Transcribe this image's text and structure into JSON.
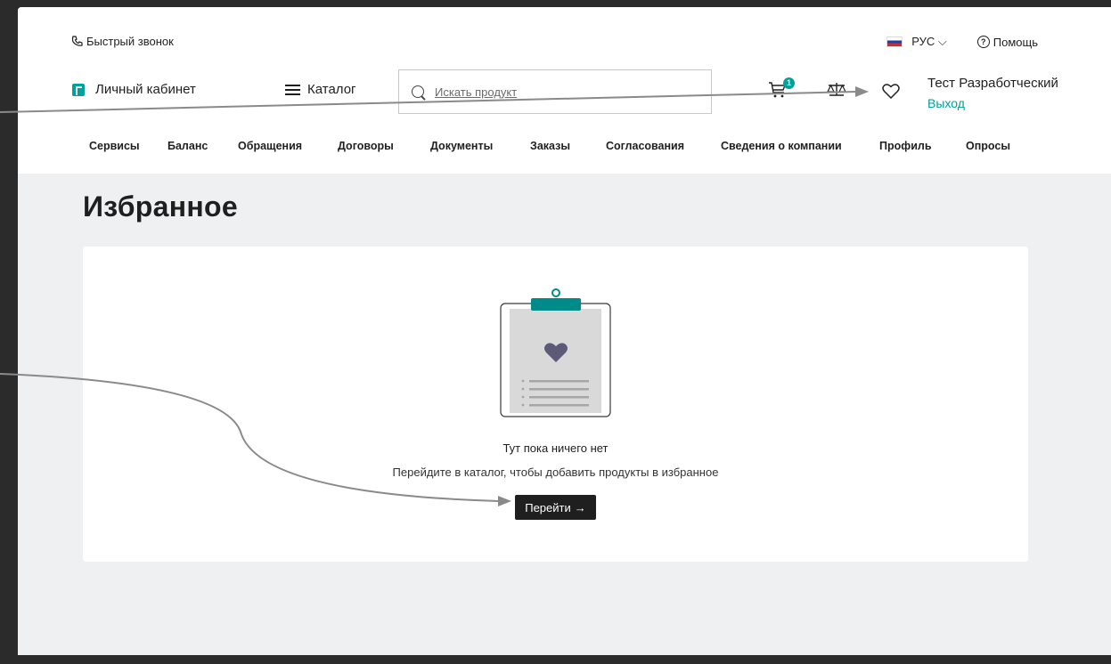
{
  "topbar": {
    "quick_call": "Быстрый звонок",
    "language": "РУС",
    "help": "Помощь"
  },
  "header": {
    "cabinet": "Личный кабинет",
    "catalog": "Каталог",
    "search_placeholder": "Искать продукт",
    "cart_count": "1",
    "user_name": "Тест Разработческий",
    "logout": "Выход"
  },
  "nav": [
    "Сервисы",
    "Баланс",
    "Обращения",
    "Договоры",
    "Документы",
    "Заказы",
    "Согласования",
    "Сведения о компании",
    "Профиль",
    "Опросы"
  ],
  "page": {
    "title": "Избранное",
    "empty_title": "Тут пока ничего нет",
    "empty_subtitle": "Перейдите в каталог, чтобы добавить продукты в избранное",
    "button_label": "Перейти",
    "button_arrow": "→"
  },
  "colors": {
    "accent": "#00a19a",
    "dark": "#1f1f1f",
    "background": "#eff0f1",
    "clip_heart": "#5d5a78"
  }
}
